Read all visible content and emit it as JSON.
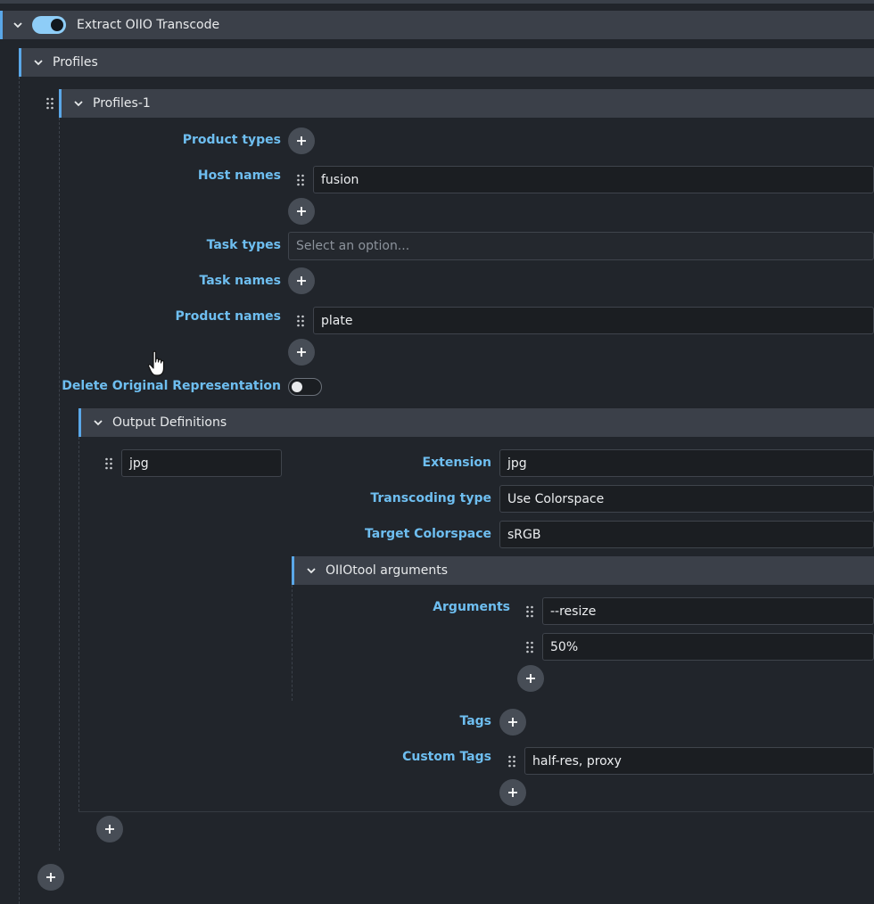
{
  "plugin": {
    "title": "Extract OIIO Transcode",
    "enabled": true
  },
  "profiles": {
    "title": "Profiles",
    "item_title": "Profiles-1",
    "fields": {
      "product_types_label": "Product types",
      "host_names_label": "Host names",
      "host_names": [
        "fusion"
      ],
      "task_types_label": "Task types",
      "task_types_placeholder": "Select an option...",
      "task_names_label": "Task names",
      "product_names_label": "Product names",
      "product_names": [
        "plate"
      ],
      "delete_original_label": "Delete Original Representation",
      "delete_original": false
    }
  },
  "output_definitions": {
    "title": "Output Definitions",
    "key": "jpg",
    "extension_label": "Extension",
    "extension": "jpg",
    "transcoding_type_label": "Transcoding type",
    "transcoding_type": "Use Colorspace",
    "target_colorspace_label": "Target Colorspace",
    "target_colorspace": "sRGB",
    "oiiotool": {
      "title": "OIIOtool arguments",
      "arguments_label": "Arguments",
      "arguments": [
        "--resize",
        "50%"
      ]
    },
    "tags_label": "Tags",
    "custom_tags_label": "Custom Tags",
    "custom_tags": [
      "half-res, proxy"
    ]
  },
  "icons": {
    "add": "plus-icon",
    "drag": "drag-handle-icon",
    "collapse": "chevron-down-icon"
  },
  "colors": {
    "accent": "#5aa7e8",
    "label": "#6ebef0",
    "background": "#21252b",
    "section_bar": "#3b4049"
  }
}
